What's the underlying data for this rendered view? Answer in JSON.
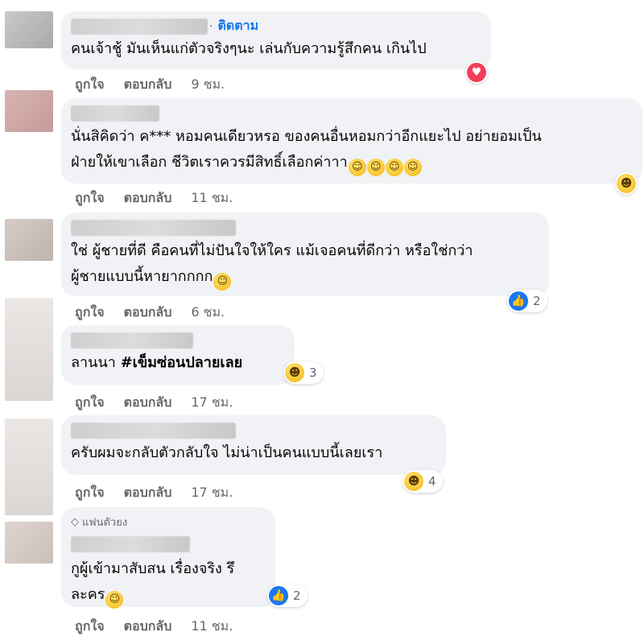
{
  "follow_label": "ติดตาม",
  "fan_badge": "แฟนตัวยง",
  "actions": {
    "like": "ถูกใจ",
    "reply": "ตอบกลับ"
  },
  "comments": [
    {
      "text": "คนเจ้าชู้ มันเห็นแก่ตัวจริงๆนะ เล่นกับความรู้สึกคน เกินไป",
      "time": "9 ชม.",
      "reaction": "love",
      "reaction_count": ""
    },
    {
      "text_1": "นั่นสิคิดว่า ค*** หอมคนเดียวหรอ ของคนอื่นหอมกว่าอีกแยะไป อย่ายอมเป็น",
      "text_2": "ฝ่ายให้เขาเลือก ชีวิตเราควรมีสิทธิ์เลือกค่าาา",
      "time": "11 ชม.",
      "reaction": "haha",
      "reaction_count": ""
    },
    {
      "text_1": "ใช่ ผู้ชายที่ดี คือคนที่ไม่ปันใจให้ใคร แม้เจอคนที่ดีกว่า หรือใช่กว่า",
      "text_2": "ผู้ชายแบบนี้หายากกกก",
      "time": "6 ชม.",
      "reaction": "like",
      "reaction_count": "2"
    },
    {
      "text_plain": "ลานนา ",
      "text_bold": "#เข็มซ่อนปลายเลย",
      "time": "17 ชม.",
      "reaction": "haha",
      "reaction_count": "3"
    },
    {
      "text": "ครับผมจะกลับตัวกลับใจ ไม่น่าเป็นคนแบบนี้เลยเรา",
      "time": "17 ชม.",
      "reaction": "haha",
      "reaction_count": "4"
    },
    {
      "text_1": "กูผู้เข้ามาสับสน เรื่องจริง รึ",
      "text_2": "ละคร",
      "time": "11 ชม.",
      "reaction": "like",
      "reaction_count": "2"
    }
  ],
  "icons": {
    "love": "heart-icon",
    "haha": "laughing-face-icon",
    "like": "thumbs-up-icon",
    "diamond": "diamond-icon"
  }
}
